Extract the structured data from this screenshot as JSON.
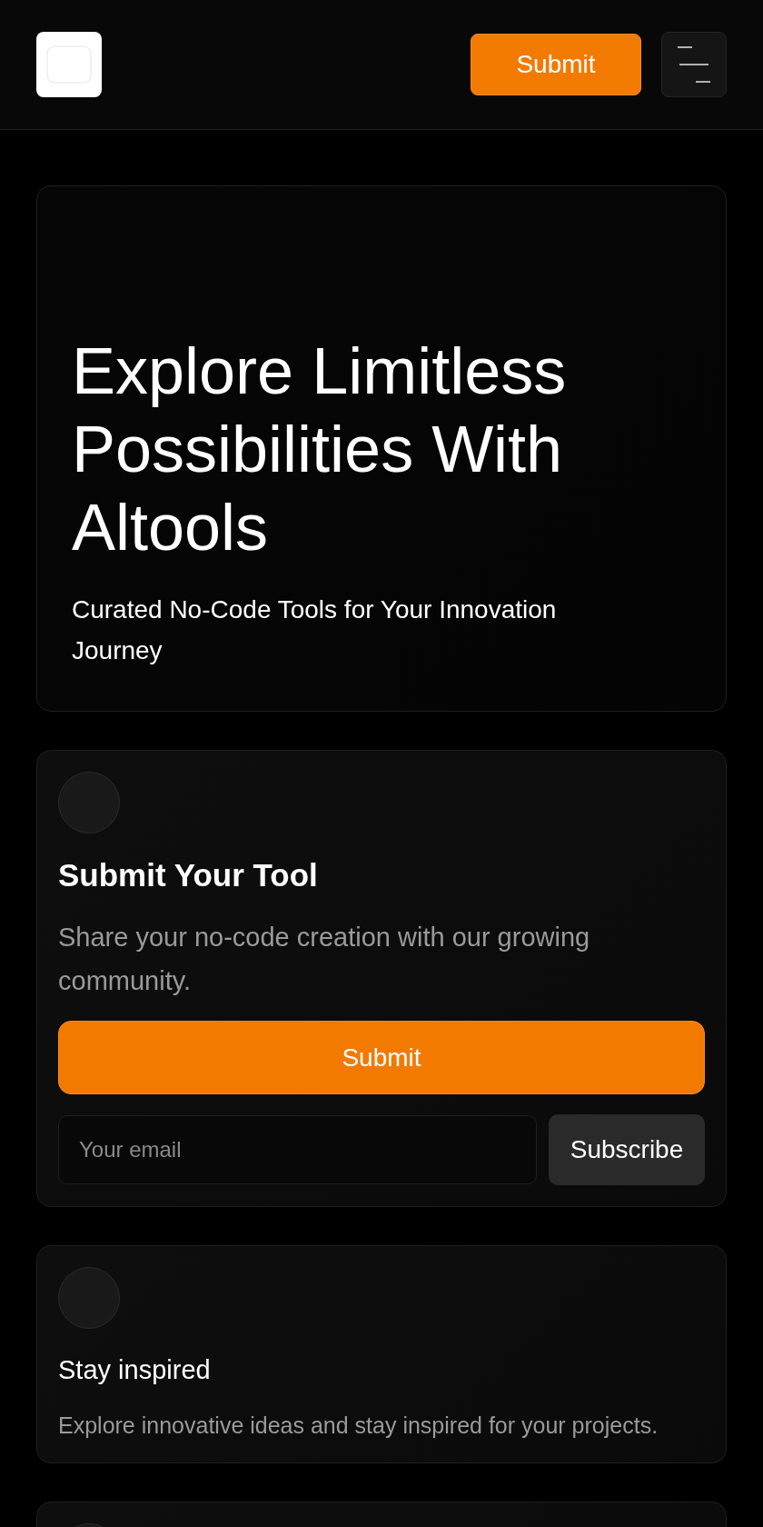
{
  "header": {
    "submit_button": "Submit"
  },
  "hero": {
    "title": "Explore Limitless Possibilities With Altools",
    "subtitle": "Curated No-Code Tools for Your Innovation Journey"
  },
  "cards": [
    {
      "kind": "submit",
      "title": "Submit Your Tool",
      "description": "Share your no-code creation with our growing community.",
      "button": "Submit",
      "email_field": {
        "placeholder": "Your email"
      },
      "subscribe_button": "Subscribe"
    },
    {
      "kind": "feature",
      "title": "Stay inspired",
      "description": "Explore innovative ideas and stay inspired for your projects."
    },
    {
      "kind": "feature"
    }
  ]
}
